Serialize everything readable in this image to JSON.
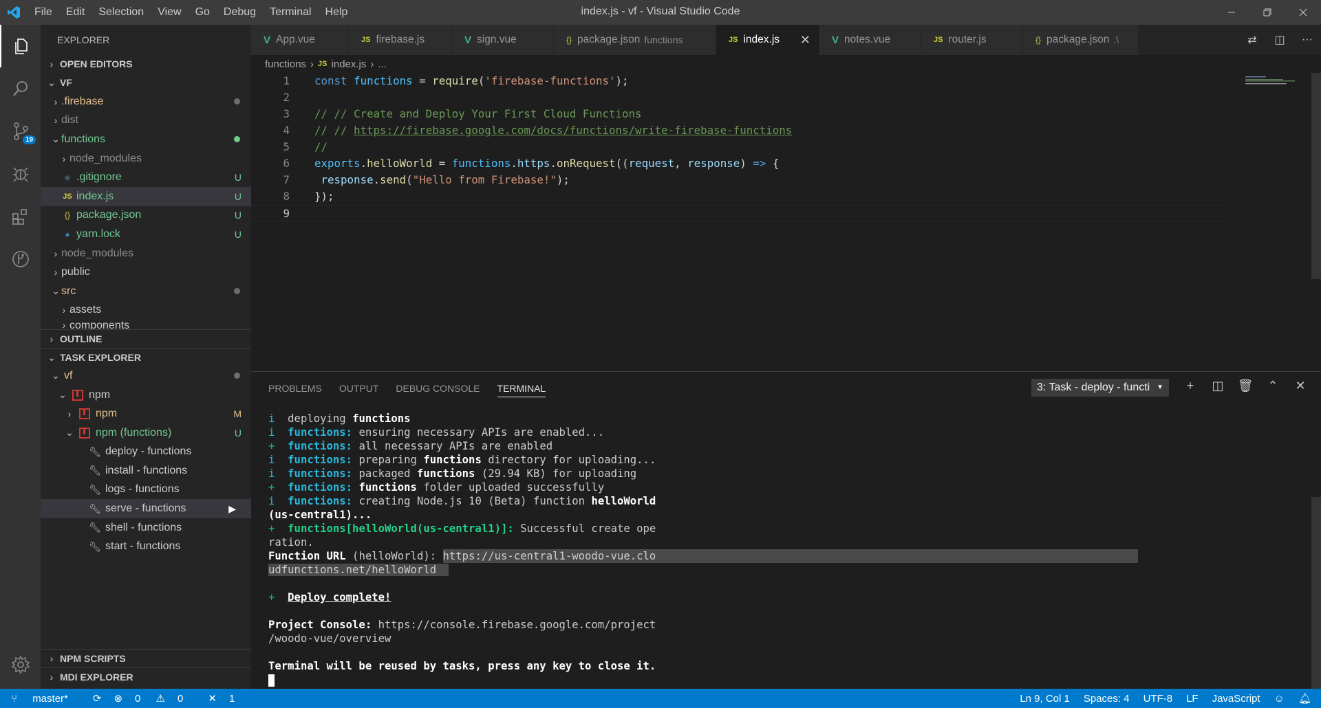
{
  "titlebar": {
    "menu": [
      "File",
      "Edit",
      "Selection",
      "View",
      "Go",
      "Debug",
      "Terminal",
      "Help"
    ],
    "title": "index.js - vf - Visual Studio Code"
  },
  "activity": {
    "scm_badge": "19"
  },
  "sidebar": {
    "title": "EXPLORER",
    "open_editors": "OPEN EDITORS",
    "folder": "VF",
    "tree": [
      {
        "label": ".firebase",
        "type": "folder",
        "deco": "dot"
      },
      {
        "label": "dist",
        "type": "folder"
      },
      {
        "label": "functions",
        "type": "folder-open",
        "deco": "dot-green"
      },
      {
        "label": "node_modules",
        "type": "folder"
      },
      {
        "label": ".gitignore",
        "type": "git",
        "deco": "U"
      },
      {
        "label": "index.js",
        "type": "js",
        "deco": "U"
      },
      {
        "label": "package.json",
        "type": "json",
        "deco": "U"
      },
      {
        "label": "yarn.lock",
        "type": "yarn",
        "deco": "U"
      },
      {
        "label": "node_modules",
        "type": "folder"
      },
      {
        "label": "public",
        "type": "folder"
      },
      {
        "label": "src",
        "type": "folder-open",
        "deco": "dot"
      },
      {
        "label": "assets",
        "type": "folder"
      },
      {
        "label": "components",
        "type": "folder"
      }
    ],
    "outline": "OUTLINE",
    "task_explorer": "TASK EXPLORER",
    "tasks": {
      "root": "vf",
      "npm": "npm",
      "npm_sub": "npm",
      "npm_sub_deco": "M",
      "npm_functions": "npm (functions)",
      "npm_functions_deco": "U",
      "items": [
        "deploy - functions",
        "install - functions",
        "logs - functions",
        "serve - functions",
        "shell - functions",
        "start - functions"
      ]
    },
    "npm_scripts": "NPM SCRIPTS",
    "mdi_explorer": "MDI EXPLORER"
  },
  "tabs": [
    {
      "label": "App.vue",
      "icon": "vue"
    },
    {
      "label": "firebase.js",
      "icon": "js"
    },
    {
      "label": "sign.vue",
      "icon": "vue"
    },
    {
      "label": "package.json",
      "icon": "json",
      "desc": "functions"
    },
    {
      "label": "index.js",
      "icon": "js",
      "active": true
    },
    {
      "label": "notes.vue",
      "icon": "vue"
    },
    {
      "label": "router.js",
      "icon": "js"
    },
    {
      "label": "package.json",
      "icon": "json",
      "desc": ".\\"
    }
  ],
  "breadcrumb": {
    "folder": "functions",
    "file": "index.js",
    "more": "..."
  },
  "editor": {
    "line_numbers": [
      "1",
      "2",
      "3",
      "4",
      "5",
      "6",
      "7",
      "8",
      "9"
    ],
    "l1": {
      "kw": "const",
      "var": "functions",
      "eq": " = ",
      "fn": "require",
      "p1": "(",
      "str": "'firebase-functions'",
      "p2": ");"
    },
    "l3": "// // Create and Deploy Your First Cloud Functions",
    "l4_prefix": "// // ",
    "l4_link": "https://firebase.google.com/docs/functions/write-firebase-functions",
    "l5": "//",
    "l6": {
      "a": "exports",
      "b": ".",
      "c": "helloWorld",
      "d": " = ",
      "e": "functions",
      "f": ".",
      "g": "https",
      "h": ".",
      "i": "onRequest",
      "j": "((",
      "k": "request",
      "l": ", ",
      "m": "response",
      "n": ") ",
      "o": "=>",
      "p": " {"
    },
    "l7": {
      "a": " response",
      "b": ".",
      "c": "send",
      "d": "(",
      "e": "\"Hello from Firebase!\"",
      "f": ");"
    },
    "l8": "});"
  },
  "panel": {
    "tabs": [
      "PROBLEMS",
      "OUTPUT",
      "DEBUG CONSOLE",
      "TERMINAL"
    ],
    "terminal_select": "3: Task - deploy - functi",
    "t1": {
      "p": "i  ",
      "a": "deploying ",
      "b": "functions"
    },
    "t2": {
      "p": "i  ",
      "a": "functions:",
      "b": " ensuring necessary APIs are enabled..."
    },
    "t3": {
      "p": "+  ",
      "a": "functions:",
      "b": " all necessary APIs are enabled"
    },
    "t4": {
      "p": "i  ",
      "a": "functions:",
      "b": " preparing ",
      "c": "functions",
      "d": " directory for uploading..."
    },
    "t5": {
      "p": "i  ",
      "a": "functions:",
      "b": " packaged ",
      "c": "functions",
      "d": " (29.94 KB) for uploading"
    },
    "t6": {
      "p": "+  ",
      "a": "functions:",
      "b": " ",
      "c": "functions",
      "d": " folder uploaded successfully"
    },
    "t7": {
      "p": "i  ",
      "a": "functions:",
      "b": " creating Node.js 10 (Beta) function ",
      "c": "helloWorld"
    },
    "t8": "(us-central1)...",
    "t9": {
      "p": "+  ",
      "a": "functions[helloWorld(us-central1)]:",
      "b": " Successful create ope"
    },
    "t10": "ration.",
    "t11": {
      "a": "Function URL",
      "b": " (helloWorld): ",
      "c": "https://us-central1-woodo-vue.clo"
    },
    "t12": "udfunctions.net/helloWorld",
    "t14": {
      "p": "+  ",
      "a": "Deploy complete!"
    },
    "t16": {
      "a": "Project Console:",
      "b": " https://console.firebase.google.com/project"
    },
    "t17": "/woodo-vue/overview",
    "t19": "Terminal will be reused by tasks, press any key to close it."
  },
  "statusbar": {
    "branch": "master*",
    "errors": "0",
    "warnings": "0",
    "live": "1",
    "position": "Ln 9, Col 1",
    "spaces": "Spaces: 4",
    "encoding": "UTF-8",
    "eol": "LF",
    "language": "JavaScript"
  },
  "colors": {
    "accent": "#007acc",
    "activity": "#333333",
    "sidebar": "#252526",
    "editor": "#1e1e1e"
  }
}
